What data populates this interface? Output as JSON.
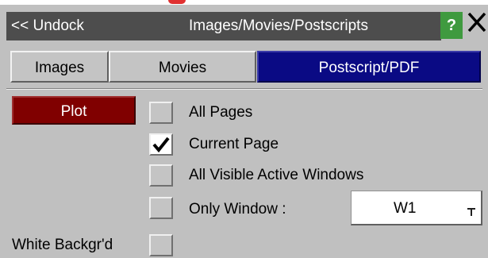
{
  "window": {
    "undock_label": "<< Undock",
    "title": "Images/Movies/Postscripts",
    "help_label": "?",
    "close_label": "✕"
  },
  "tabs": [
    {
      "label": "Images",
      "active": false
    },
    {
      "label": "Movies",
      "active": false
    },
    {
      "label": "Postscript/PDF",
      "active": true
    }
  ],
  "plot_button": {
    "label": "Plot"
  },
  "options": [
    {
      "label": "All Pages",
      "checked": false
    },
    {
      "label": "Current Page",
      "checked": true
    },
    {
      "label": "All Visible Active Windows",
      "checked": false
    },
    {
      "label": "Only Window :",
      "checked": false
    }
  ],
  "window_select": {
    "value": "W1"
  },
  "white_background": {
    "label": "White Backgr'd",
    "checked": false
  },
  "colors": {
    "panel": "#c0c0c0",
    "titlebar": "#4d4d4d",
    "active_tab": "#0a0a84",
    "plot_button": "#800000",
    "help_button": "#3f9a3f"
  }
}
